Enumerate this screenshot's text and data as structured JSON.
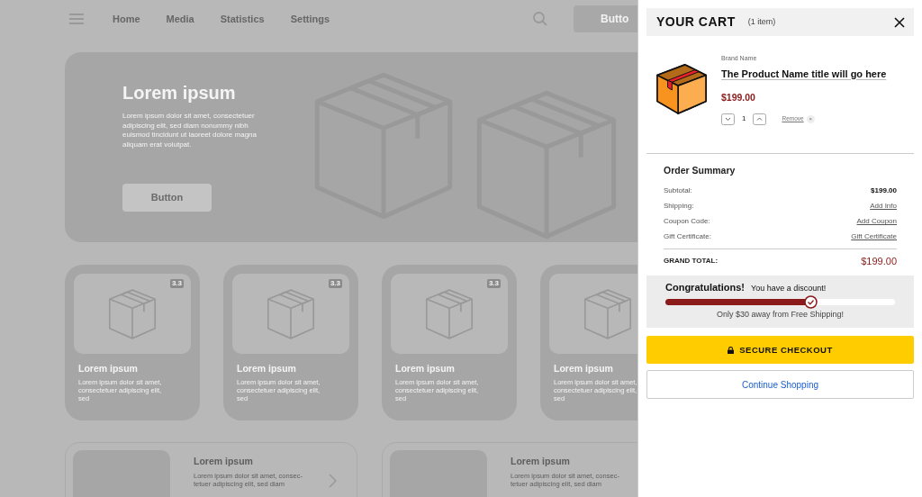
{
  "nav": {
    "items": [
      {
        "label": "Home"
      },
      {
        "label": "Media"
      },
      {
        "label": "Statistics"
      },
      {
        "label": "Settings"
      }
    ],
    "button": "Butto"
  },
  "hero": {
    "title": "Lorem ipsum",
    "text": "Lorem ipsum dolor sit amet, consectetuer adipiscing elit, sed diam nonummy nibh euismod tincidunt ut laoreet dolore magna aliquam erat volutpat.",
    "button": "Button"
  },
  "cards": [
    {
      "badge": "3.3",
      "title": "Lorem ipsum",
      "text": "Lorem ipsum dolor sit amet, consectetuer adipiscing elit, sed"
    },
    {
      "badge": "3.3",
      "title": "Lorem ipsum",
      "text": "Lorem ipsum dolor sit amet, consectetuer adipiscing elit, sed"
    },
    {
      "badge": "3.3",
      "title": "Lorem ipsum",
      "text": "Lorem ipsum dolor sit amet, consectetuer adipiscing elit, sed"
    },
    {
      "title": "Lorem ipsum",
      "text": "Lorem ipsum dolor sit amet, consectetuer adipiscing elit, sed"
    }
  ],
  "list_cards": [
    {
      "title": "Lorem ipsum",
      "text_lines": [
        "Lorem ipsum dolor sit amet, consec-",
        "tetuer adipiscing elit, sed diam"
      ],
      "chevron": true
    },
    {
      "title": "Lorem ipsum",
      "text_lines": [
        "Lorem ipsum dolor sit amet, consec-",
        "tetuer adipiscing elit, sed diam"
      ]
    }
  ],
  "cart": {
    "title": "YOUR CART",
    "count": "(1 item)",
    "item": {
      "brand": "Brand Name",
      "name": "The Product Name title will go here",
      "price": "$199.00",
      "quantity": "1",
      "remove": "Remove",
      "remove_icon": "×"
    },
    "summary": {
      "title": "Order Summary",
      "rows": [
        {
          "label": "Subtotal:",
          "value": "$199.00",
          "kind": "amount"
        },
        {
          "label": "Shipping:",
          "value": "Add Info",
          "kind": "link"
        },
        {
          "label": "Coupon Code:",
          "value": "Add Coupon",
          "kind": "link"
        },
        {
          "label": "Gift Certificate:",
          "value": "Gift Certificate",
          "kind": "link"
        }
      ],
      "total_label": "GRAND TOTAL:",
      "total": "$199.00"
    },
    "discount": {
      "headline": "Congratulations!",
      "message": "You have a discount!",
      "level": 0.63,
      "note": "Only $30 away from Free Shipping!"
    },
    "checkout": "SECURE CHECKOUT",
    "continue": "Continue Shopping"
  }
}
